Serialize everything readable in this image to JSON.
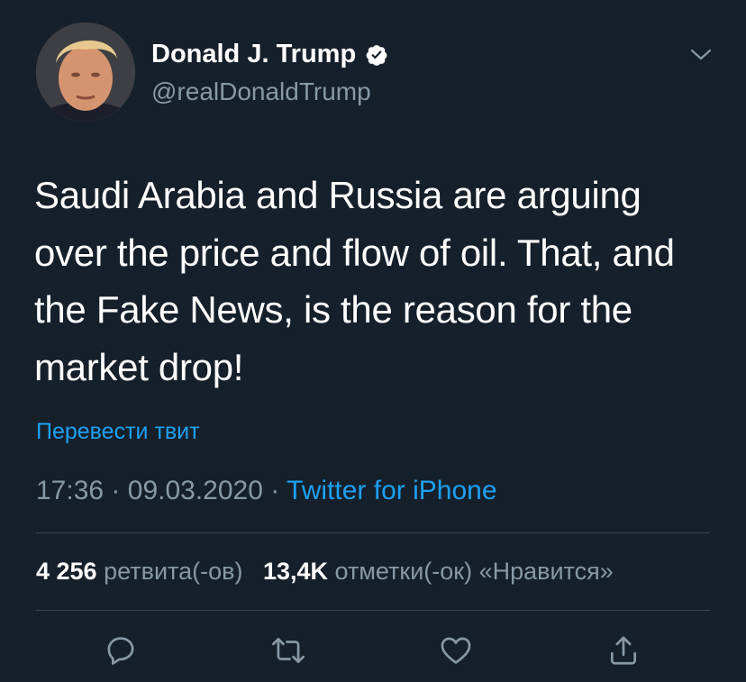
{
  "author": {
    "name": "Donald J. Trump",
    "handle": "@realDonaldTrump",
    "verified": true
  },
  "tweet": {
    "text": "Saudi Arabia and Russia are arguing over the price and flow of oil. That, and the Fake News, is the reason for the market drop!",
    "translate_label": "Перевести твит",
    "time": "17:36",
    "date": "09.03.2020",
    "separator": "·",
    "source": "Twitter for iPhone"
  },
  "stats": {
    "retweets_count": "4 256",
    "retweets_label": "ретвита(-ов)",
    "likes_count": "13,4K",
    "likes_label": "отметки(-ок) «Нравится»"
  },
  "actions": {
    "icons": [
      "reply-icon",
      "retweet-icon",
      "like-icon",
      "share-icon"
    ]
  },
  "colors": {
    "background": "#15202b",
    "accent": "#1da1f2",
    "secondary_text": "#8899a6",
    "divider": "#38444d"
  }
}
